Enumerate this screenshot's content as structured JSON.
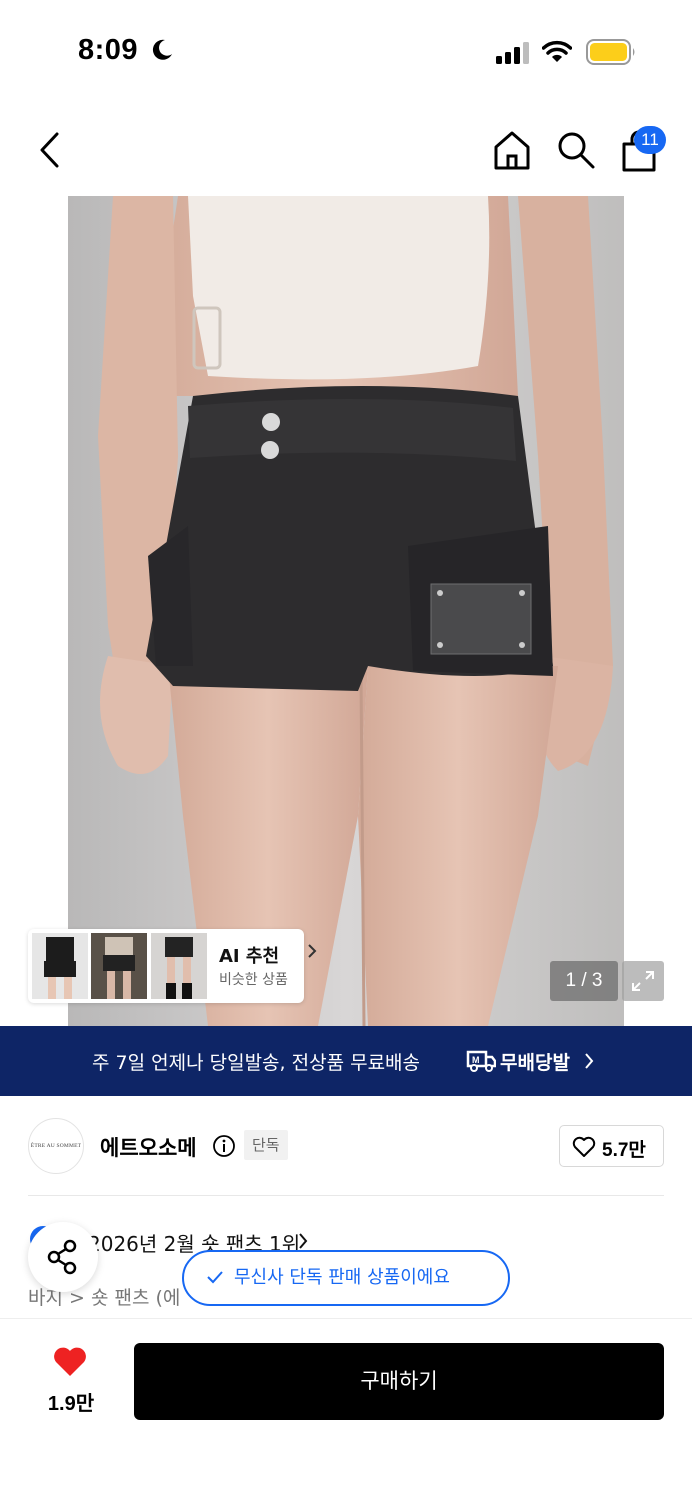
{
  "status_bar": {
    "time": "8:09"
  },
  "header": {
    "cart_count": "11"
  },
  "gallery": {
    "counter": "1 / 3",
    "ai": {
      "title": "AI 추천",
      "subtitle": "비슷한 상품"
    }
  },
  "promo": {
    "text": "주 7일 언제나 당일발송, 전상품 무료배송",
    "brand": "무배당발"
  },
  "brand": {
    "logo_text": "ÊTRE AU SOMMET",
    "name": "에트오소메",
    "tag": "단독",
    "likes": "5.7만"
  },
  "product": {
    "ranking": "2026년 2월 숏 팬츠 1위",
    "breadcrumb": "바지 > 숏 팬츠 (에",
    "exclusive_notice": "무신사 단독 판매 상품이에요"
  },
  "bottom": {
    "wish_count": "1.9만",
    "buy_label": "구매하기"
  },
  "colors": {
    "accent_blue": "#1768f3",
    "promo_navy": "#0e2566",
    "wish_red": "#ee2222"
  }
}
